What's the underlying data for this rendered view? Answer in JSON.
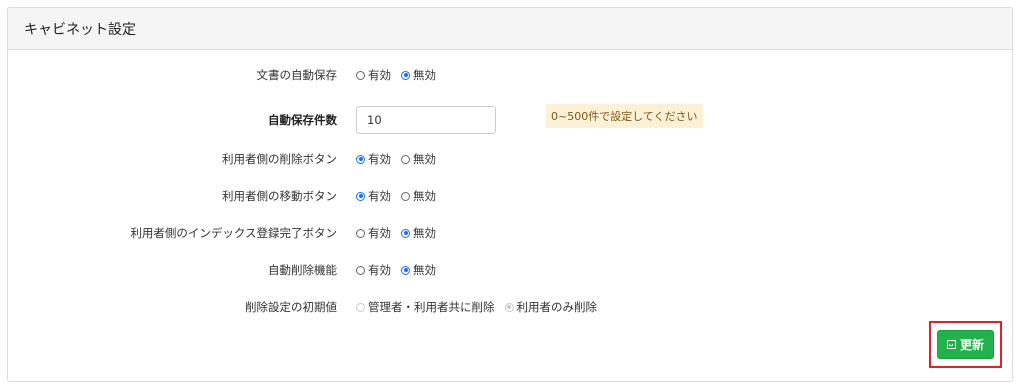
{
  "panel": {
    "title": "キャビネット設定"
  },
  "settings": [
    {
      "label": "文書の自動保存",
      "options": [
        "有効",
        "無効"
      ],
      "selected": 1
    },
    {
      "label": "自動保存件数",
      "value": "10",
      "hint": "0~500件で設定してください"
    },
    {
      "label": "利用者側の削除ボタン",
      "options": [
        "有効",
        "無効"
      ],
      "selected": 0
    },
    {
      "label": "利用者側の移動ボタン",
      "options": [
        "有効",
        "無効"
      ],
      "selected": 0
    },
    {
      "label": "利用者側のインデックス登録完了ボタン",
      "options": [
        "有効",
        "無効"
      ],
      "selected": 1
    },
    {
      "label": "自動削除機能",
      "options": [
        "有効",
        "無効"
      ],
      "selected": 1
    },
    {
      "label": "削除設定の初期値",
      "options": [
        "管理者・利用者共に削除",
        "利用者のみ削除"
      ],
      "selected": 1,
      "disabled": true
    }
  ],
  "footer": {
    "save_label": "更新",
    "save_icon": "save-icon"
  },
  "colors": {
    "accent": "#1a6ef5",
    "save_button": "#22b24c",
    "highlight_border": "#e0202a",
    "hint_bg": "#fcf1d6"
  }
}
